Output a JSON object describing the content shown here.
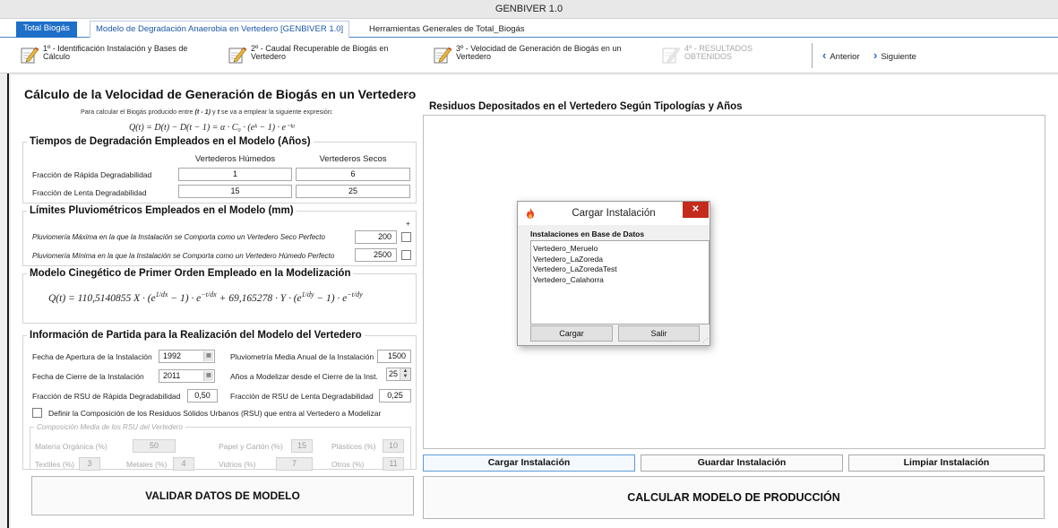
{
  "app": {
    "title": "GENBIVER 1.0"
  },
  "tabs": {
    "brand": "Total Biogás",
    "active": "Modelo de Degradación Anaerobia en Vertedero [GENBIVER 1.0]",
    "third": "Herramientas Generales de Total_Biogás"
  },
  "steps": [
    {
      "line1": "1º - Identificación Instalación y Bases de",
      "line2": "Cálculo",
      "icon": "pencil-paper-icon"
    },
    {
      "line1": "2º - Caudal Recuperable de Biogás en",
      "line2": "Vertedero",
      "icon": "pencil-paper-icon"
    },
    {
      "line1": "3º - Velocidad de Generación de Biogás en un",
      "line2": "Vertedero",
      "icon": "pencil-paper-icon"
    },
    {
      "line1": "4º - RESULTADOS",
      "line2": "OBTENIDOS",
      "icon": "pencil-paper-icon"
    }
  ],
  "nav": {
    "prev": "Anterior",
    "next": "Siguiente"
  },
  "main": {
    "title": "Cálculo de la Velocidad de Generación de Biogás en un Vertedero",
    "intro_a": "Para calcular el Biogás producido entre ",
    "intro_b": "(t - 1)",
    "intro_c": " y ",
    "intro_d": "t",
    "intro_e": " se va a emplear la siguiente expresión:",
    "formula_main": "Q(t) = D(t) − D(t − 1) = α · C₀ · (eᵏ − 1) · e⁻ᵏᵗ"
  },
  "degradation": {
    "legend": "Tiempos de Degradación Empleados en el Modelo (Años)",
    "col_wet": "Vertederos Húmedos",
    "col_dry": "Vertederos Secos",
    "rows": [
      {
        "label": "Fracción de Rápida Degradabilidad",
        "wet": "1",
        "dry": "6"
      },
      {
        "label": "Fracción de Lenta Degradabilidad",
        "wet": "15",
        "dry": "25"
      }
    ]
  },
  "rain": {
    "legend": "Límites Pluviométricos Empleados en el Modelo (mm)",
    "plus": "+",
    "max_label": "Pluviomería Máxima en la que la Instalación se Comporta como un Vertedero Seco Perfecto",
    "max_value": "200",
    "min_label": "Pluviomería Mínima en la que la Instalación se Comporta como un Vertedero Húmedo Perfecto",
    "min_value": "2500"
  },
  "kinetic": {
    "legend": "Modelo Cinegético de Primer Orden Empleado en la Modelización",
    "coef_x": "110,5140855",
    "coef_y": "69,165278"
  },
  "info": {
    "legend": "Información de Partida para la Realización del Modelo del Vertedero",
    "open_label": "Fecha de Apertura de la Instalación",
    "open_value": "1992",
    "close_label": "Fecha de Cierre de la Instalación",
    "close_value": "2011",
    "rain_label": "Pluviometría Media Anual de la Instalación",
    "rain_value": "1500",
    "years_label": "Años a Modelizar desde el Cierre de la Inst.",
    "years_value": "25",
    "fast_label": "Fracción de RSU de Rápida Degradabilidad",
    "fast_value": "0,50",
    "slow_label": "Fracción de RSU de Lenta Degradabilidad",
    "slow_value": "0,25",
    "define_label": "Definir la Composición de los Residuos Sólidos Urbanos (RSU) que entra al Vertedero a Modelizar"
  },
  "composition": {
    "legend": "Composición Media de los RSU del Vertedero",
    "organic_label": "Materia Orgánica (%)",
    "organic": "50",
    "paper_label": "Papel y Cartón (%)",
    "paper": "15",
    "plastic_label": "Plásticos (%)",
    "plastic": "10",
    "textile_label": "Textiles (%)",
    "textile": "3",
    "metal_label": "Metales (%)",
    "metal": "4",
    "glass_label": "Vidrios (%)",
    "glass": "7",
    "other_label": "Otros (%)",
    "other": "11"
  },
  "buttons": {
    "validate": "VALIDAR DATOS DE MODELO",
    "calculate": "CALCULAR MODELO DE PRODUCCIÓN",
    "load": "Cargar Instalación",
    "save": "Guardar Instalación",
    "clear": "Limpiar Instalación"
  },
  "right_panel": {
    "title": "Residuos Depositados en el Vertedero Según Tipologías y Años"
  },
  "dialog": {
    "title": "Cargar Instalación",
    "close": "✕",
    "group": "Instalaciones en Base de Datos",
    "items": [
      "Vertedero_Meruelo",
      "Vertedero_LaZoreda",
      "Vertedero_LaZoredaTest",
      "Vertedero_Calahorra"
    ],
    "load": "Cargar",
    "exit": "Salir"
  },
  "colors": {
    "accent": "#1e6fc8",
    "close_red": "#c42b1c",
    "flame": "#e8431f"
  }
}
